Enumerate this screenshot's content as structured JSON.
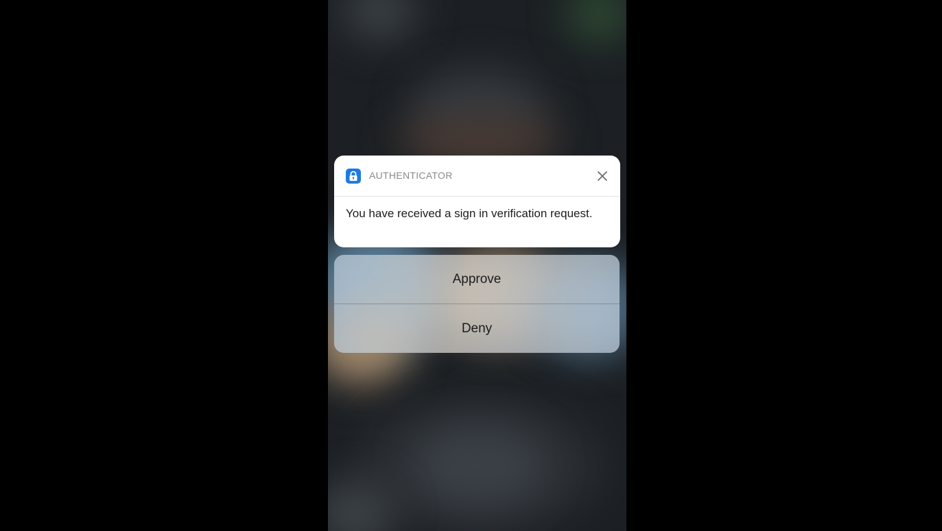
{
  "notification": {
    "app_name": "AUTHENTICATOR",
    "app_icon": "lock-icon",
    "close_icon": "close-icon",
    "message": "You have received a sign in verification request."
  },
  "actions": {
    "approve_label": "Approve",
    "deny_label": "Deny"
  },
  "colors": {
    "app_icon_bg": "#1f7ae0",
    "background": "#000000"
  }
}
